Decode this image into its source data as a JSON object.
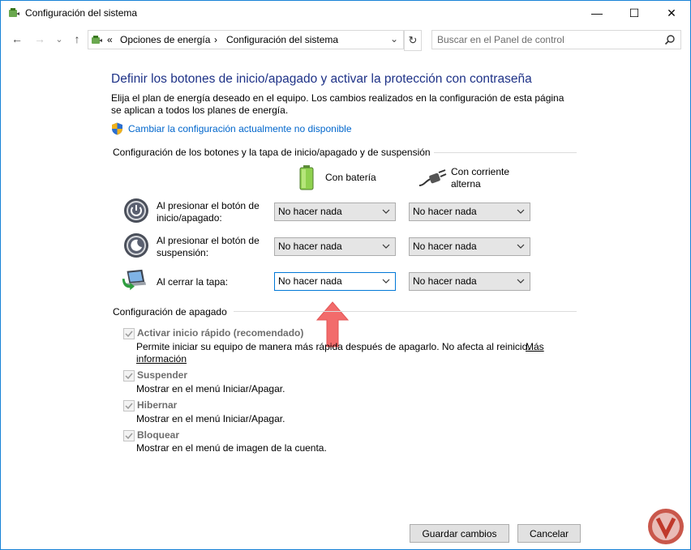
{
  "window": {
    "title": "Configuración del sistema",
    "minimize_glyph": "—",
    "maximize_glyph": "☐",
    "close_glyph": "✕"
  },
  "address": {
    "back_glyph": "←",
    "forward_glyph": "→",
    "recent_glyph": "⌄",
    "up_glyph": "↑",
    "overflow": "«",
    "crumbs": [
      "Opciones de energía",
      "Configuración del sistema"
    ],
    "separator": "›",
    "dropdown_glyph": "⌄",
    "refresh_glyph": "↻"
  },
  "search": {
    "placeholder": "Buscar en el Panel de control"
  },
  "main": {
    "heading": "Definir los botones de inicio/apagado y activar la protección con contraseña",
    "description": "Elija el plan de energía deseado en el equipo. Los cambios realizados en la configuración de esta página se aplican a todos los planes de energía.",
    "change_link": "Cambiar la configuración actualmente no disponible"
  },
  "buttons_section": {
    "title": "Configuración de los botones y la tapa de inicio/apagado y de suspensión",
    "col_battery": "Con batería",
    "col_ac_line1": "Con corriente",
    "col_ac_line2": "alterna",
    "rows": [
      {
        "label_line1": "Al presionar el botón de",
        "label_line2": "inicio/apagado:",
        "battery": "No hacer nada",
        "ac": "No hacer nada"
      },
      {
        "label_line1": "Al presionar el botón de",
        "label_line2": "suspensión:",
        "battery": "No hacer nada",
        "ac": "No hacer nada"
      },
      {
        "label_line1": "Al cerrar la tapa:",
        "label_line2": "",
        "battery": "No hacer nada",
        "ac": "No hacer nada"
      }
    ]
  },
  "shutdown_section": {
    "title": "Configuración de apagado",
    "fast_startup": {
      "label": "Activar inicio rápido (recomendado)",
      "desc": "Permite iniciar su equipo de manera más rápida después de apagarlo. No afecta al reinicio.",
      "more_link_line1": "Más",
      "more_link_line2": "información",
      "checked": true
    },
    "sleep": {
      "label": "Suspender",
      "desc": "Mostrar en el menú Iniciar/Apagar.",
      "checked": true
    },
    "hibernate": {
      "label": "Hibernar",
      "desc": "Mostrar en el menú Iniciar/Apagar.",
      "checked": true
    },
    "lock": {
      "label": "Bloquear",
      "desc": "Mostrar en el menú de imagen de la cuenta.",
      "checked": true
    }
  },
  "footer": {
    "save_label": "Guardar cambios",
    "cancel_label": "Cancelar"
  },
  "colors": {
    "heading": "#1e3287",
    "link": "#0066cc",
    "annotation_arrow": "#f26b6b",
    "watermark": "#c0392b"
  }
}
